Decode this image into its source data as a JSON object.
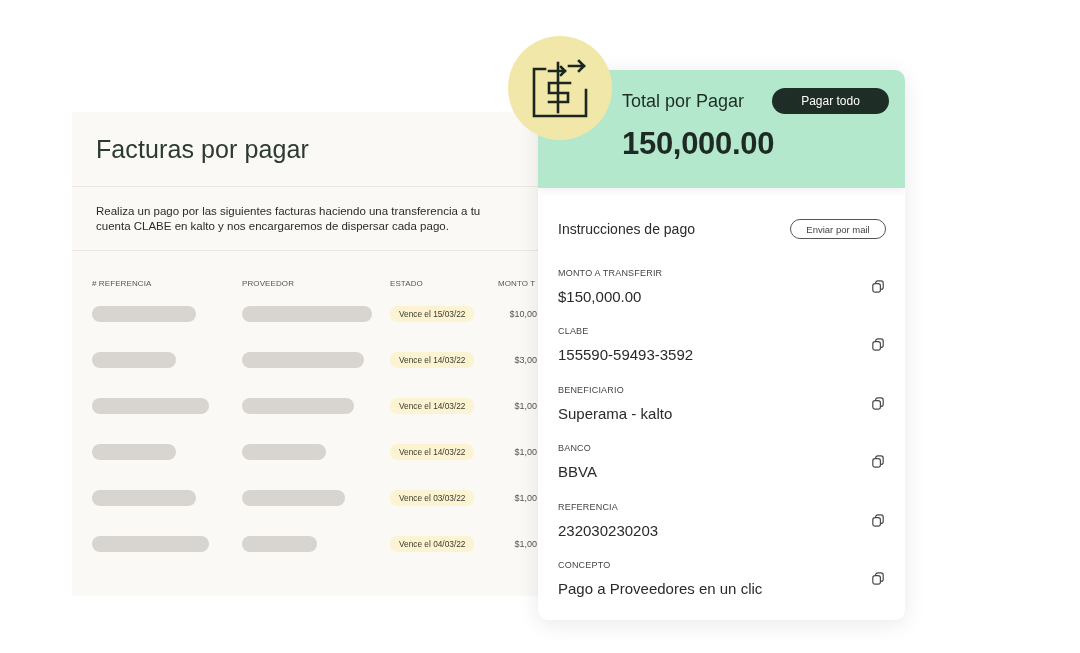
{
  "invoices_panel": {
    "title": "Facturas por pagar",
    "description": "Realiza un pago por las siguientes facturas haciendo una transferencia a tu cuenta CLABE en kalto y nos encargaremos de dispersar cada pago.",
    "table": {
      "columns": [
        "# REFERENCIA",
        "PROVEEDOR",
        "ESTADO",
        "MONTO T"
      ],
      "rows": [
        {
          "status": "Vence el 15/03/22",
          "amount": "$10,00"
        },
        {
          "status": "Vence el 14/03/22",
          "amount": "$3,00"
        },
        {
          "status": "Vence el 14/03/22",
          "amount": "$1,00"
        },
        {
          "status": "Vence el 14/03/22",
          "amount": "$1,00"
        },
        {
          "status": "Vence el 03/03/22",
          "amount": "$1,00"
        },
        {
          "status": "Vence el 04/03/22",
          "amount": "$1,00"
        }
      ]
    }
  },
  "payment_card": {
    "total_label": "Total por Pagar",
    "pay_all_button": "Pagar todo",
    "total_amount": "150,000.00",
    "instructions_title": "Instrucciones de pago",
    "email_button": "Enviar por mail",
    "fields": [
      {
        "label": "MONTO A TRANSFERIR",
        "value": "$150,000.00"
      },
      {
        "label": "CLABE",
        "value": "155590-59493-3592"
      },
      {
        "label": "BENEFICIARIO",
        "value": "Superama - kalto"
      },
      {
        "label": "BANCO",
        "value": "BBVA"
      },
      {
        "label": "REFERENCIA",
        "value": "232030230203"
      },
      {
        "label": "CONCEPTO",
        "value": "Pago a Proveedores en un clic"
      }
    ]
  }
}
